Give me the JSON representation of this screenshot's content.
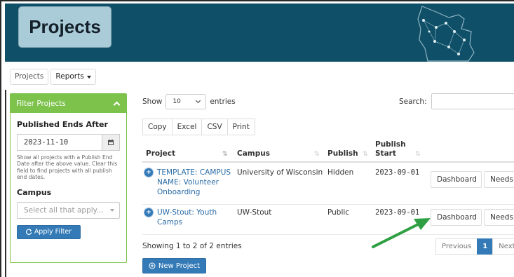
{
  "header": {
    "title": "Projects"
  },
  "tabs": [
    {
      "label": "Projects"
    },
    {
      "label": "Reports"
    }
  ],
  "filter": {
    "title": "Filter Projects",
    "published_label": "Published Ends After",
    "date_value": "2023-11-10",
    "help_text": "Show all projects with a Publish End Date after the above value. Clear this field to find projects with all publish end dates.",
    "campus_label": "Campus",
    "campus_placeholder": "Select all that apply...",
    "apply_label": "Apply Filter"
  },
  "table_controls": {
    "show_label": "Show",
    "page_length": "10",
    "entries_label": "entries",
    "search_label": "Search:",
    "export_buttons": [
      "Copy",
      "Excel",
      "CSV",
      "Print"
    ]
  },
  "table": {
    "headers": [
      "Project",
      "Campus",
      "Publish",
      "Publish Start"
    ],
    "rows": [
      {
        "project": "TEMPLATE: CAMPUS NAME: Volunteer Onboarding",
        "campus": "University of Wisconsin",
        "publish": "Hidden",
        "publish_start": "2023-09-01",
        "actions": [
          "Dashboard",
          "Needs"
        ]
      },
      {
        "project": "UW-Stout: Youth Camps",
        "campus": "UW-Stout",
        "publish": "Public",
        "publish_start": "2023-09-01",
        "actions": [
          "Dashboard",
          "Needs"
        ]
      }
    ]
  },
  "info_text": "Showing 1 to 2 of 2 entries",
  "pagination": {
    "previous": "Previous",
    "current": "1",
    "next": "Next"
  },
  "new_project_label": "New Project",
  "colors": {
    "banner": "#0f5068",
    "panel_green": "#7cc24b",
    "primary": "#337ab7",
    "link": "#2a6ca7",
    "arrow": "#2ea043"
  }
}
